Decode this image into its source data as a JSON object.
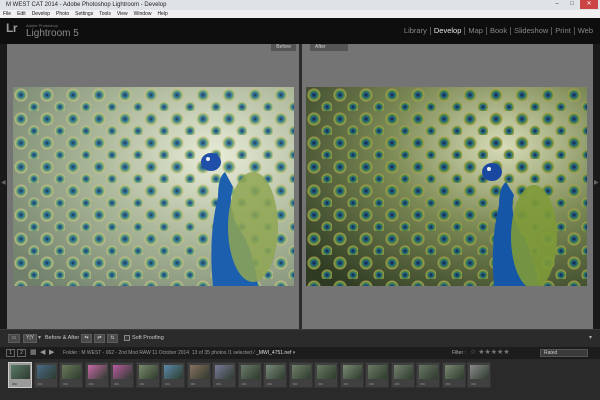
{
  "window": {
    "title": "M WEST CAT 2014 - Adobe Photoshop Lightroom - Develop",
    "min_glyph": "–",
    "max_glyph": "□",
    "close_glyph": "✕"
  },
  "menu": [
    "File",
    "Edit",
    "Develop",
    "Photo",
    "Settings",
    "Tools",
    "View",
    "Window",
    "Help"
  ],
  "identity": {
    "logo": "Lr",
    "vendor": "Adobe Photoshop",
    "product": "Lightroom 5"
  },
  "modules": [
    "Library",
    "Develop",
    "Map",
    "Book",
    "Slideshow",
    "Print",
    "Web"
  ],
  "active_module": "Develop",
  "panes": {
    "before_label": "Before",
    "after_label": "After"
  },
  "toolbar": {
    "view_icon": "loupe-icon",
    "yy_label": "Y|Y",
    "before_after_label": "Before & After :",
    "soft_proofing_label": "Soft Proofing",
    "caret": "▾"
  },
  "filmstrip": {
    "screen1": "1",
    "screen2": "2",
    "grid_glyph": "▦",
    "back_glyph": "◀",
    "forward_glyph": "▶",
    "path": "Folder : M WEST - 062 - 2nd Mod RAW 11 October 2014",
    "count": "13 of 35 photos /1 selected /",
    "filename": "_MWI_4751.nef",
    "filename_caret": "▾",
    "filter_label": "Filter :",
    "stars": "☆ ★★★★★",
    "rating_filter": "Rated",
    "thumbnail_count": 19,
    "selected_index": 0
  },
  "colors": {
    "canvas": "#747474",
    "peacock_blue": "#1b5fae",
    "active_module": "#e6e6e6"
  }
}
